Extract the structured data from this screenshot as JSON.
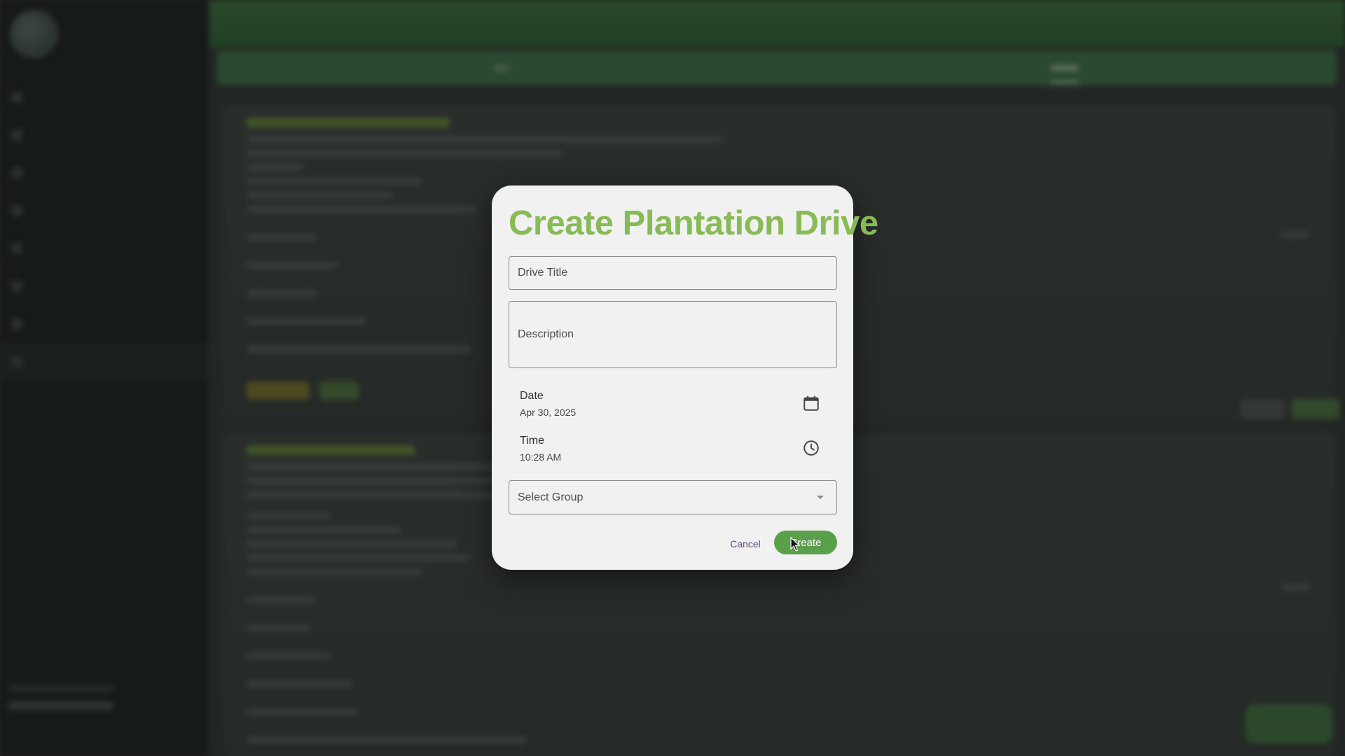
{
  "dialog": {
    "title": "Create Plantation Drive",
    "drive_title_placeholder": "Drive Title",
    "description_placeholder": "Description",
    "date_label": "Date",
    "date_value": "Apr 30, 2025",
    "time_label": "Time",
    "time_value": "10:28 AM",
    "group_select_placeholder": "Select Group",
    "cancel_label": "Cancel",
    "create_label": "Create"
  },
  "icons": {
    "date": "calendar-icon",
    "time": "clock-icon",
    "select": "chevron-down-icon"
  },
  "colors": {
    "title_green": "#88bb55",
    "create_button": "#5aa04b",
    "cancel_text": "#5a4a8a",
    "dialog_bg": "#f1f1f1"
  }
}
